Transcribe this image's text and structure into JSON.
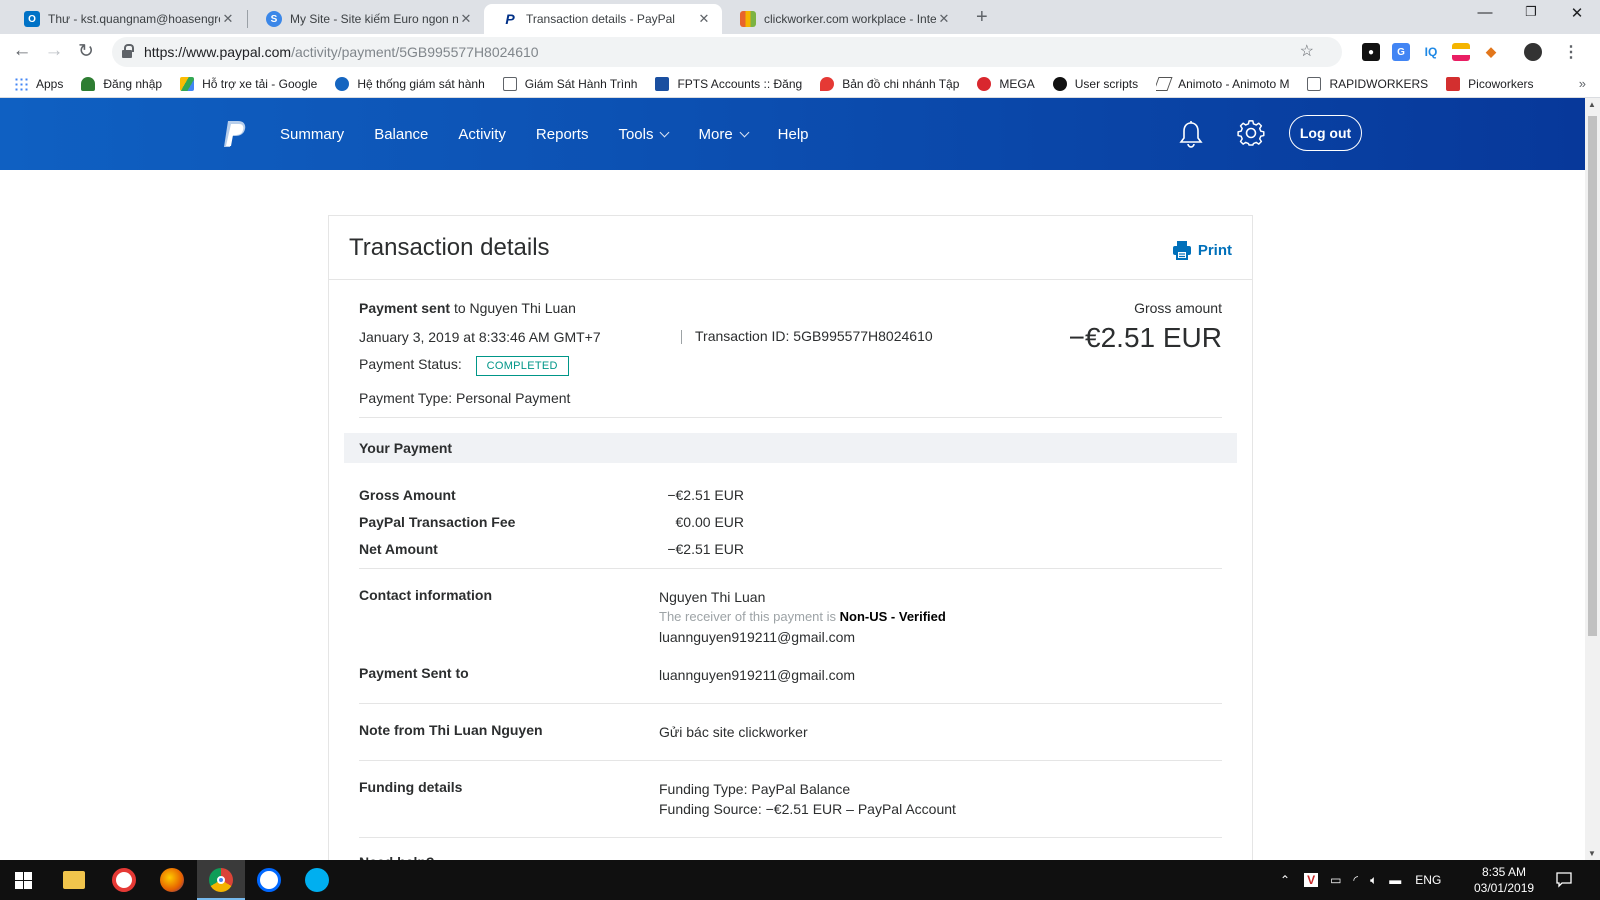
{
  "browser": {
    "tabs": [
      {
        "title": "Thư - kst.quangnam@hoasengroup",
        "icon": "outlook-icon",
        "color": "#0072c6"
      },
      {
        "title": "My Site - Site kiếm Euro ngon nhất",
        "icon": "site-s-icon",
        "color": "#3b87e8"
      },
      {
        "title": "Transaction details - PayPal",
        "icon": "paypal-icon",
        "color": "#003087"
      },
      {
        "title": "clickworker.com workplace - Internet",
        "icon": "clickworker-icon",
        "color": "#e8642c"
      }
    ],
    "url_host": "https://www.paypal.com",
    "url_path": "/activity/payment/5GB995577H8024610",
    "bookmarks": [
      {
        "label": "Apps",
        "color": "#4285f4"
      },
      {
        "label": "Đăng nhập",
        "color": "#2e7d32"
      },
      {
        "label": "Hỗ trợ xe tải - Google",
        "color": "#fbbc04"
      },
      {
        "label": "Hệ thống giám sát hành",
        "color": "#1565c0"
      },
      {
        "label": "Giám Sát Hành Trình",
        "color": "#ffffff"
      },
      {
        "label": "FPTS Accounts :: Đăng",
        "color": "#1a4fa0"
      },
      {
        "label": "Bản đồ chi nhánh Tập",
        "color": "#e53935"
      },
      {
        "label": "MEGA",
        "color": "#d9272e"
      },
      {
        "label": "User scripts",
        "color": "#111111"
      },
      {
        "label": "Animoto - Animoto M",
        "color": "#555555"
      },
      {
        "label": "RAPIDWORKERS",
        "color": "#ffffff"
      },
      {
        "label": "Picoworkers",
        "color": "#d32f2f"
      }
    ]
  },
  "nav": {
    "items": [
      "Summary",
      "Balance",
      "Activity",
      "Reports",
      "Tools",
      "More",
      "Help"
    ],
    "logout": "Log out"
  },
  "transaction": {
    "title": "Transaction details",
    "print": "Print",
    "sent_label": "Payment sent",
    "sent_to": "to Nguyen Thi Luan",
    "date": "January 3, 2019 at 8:33:46 AM GMT+7",
    "txid_label": "Transaction ID: 5GB995577H8024610",
    "status_label": "Payment Status:",
    "status": "COMPLETED",
    "type_line": "Payment Type: Personal Payment",
    "gross_label": "Gross amount",
    "gross_amount": "−€2.51 EUR",
    "section_title": "Your Payment",
    "amounts": [
      {
        "label": "Gross Amount",
        "value": "−€2.51 EUR"
      },
      {
        "label": "PayPal Transaction Fee",
        "value": "€0.00 EUR"
      },
      {
        "label": "Net Amount",
        "value": "−€2.51 EUR"
      }
    ],
    "contact": {
      "label": "Contact information",
      "name": "Nguyen Thi Luan",
      "receiver_prefix": "The receiver of this payment is",
      "receiver_status": "Non-US - Verified",
      "email": "luannguyen919211@gmail.com"
    },
    "sent_to_row": {
      "label": "Payment Sent to",
      "value": "luannguyen919211@gmail.com"
    },
    "note": {
      "label": "Note from Thi Luan Nguyen",
      "value": "Gửi bác site clickworker"
    },
    "funding": {
      "label": "Funding details",
      "type": "Funding Type: PayPal Balance",
      "source": "Funding Source: −€2.51 EUR – PayPal Account"
    },
    "help": "Need help?"
  },
  "taskbar": {
    "lang": "ENG",
    "time": "8:35 AM",
    "date": "03/01/2019"
  },
  "colors": {
    "paypal_blue": "#0c4fb1",
    "link_blue": "#0070ba",
    "completed": "#009688"
  }
}
